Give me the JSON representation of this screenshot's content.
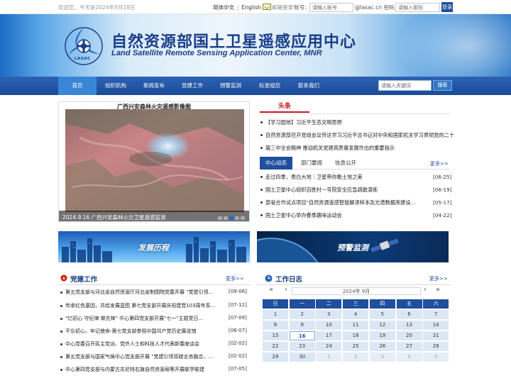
{
  "topbar": {
    "welcome": "欢迎您，今天是2024年9月18日",
    "lang_cn": "简体中文",
    "lang_sep": "|",
    "lang_en": "English",
    "mail_login": "邮箱登录",
    "account_label": "账号：",
    "account_placeholder": "请输入账号",
    "domain_suffix": "@lasac.cn  密码：",
    "password_placeholder": "请输入密码",
    "login_button": "登录"
  },
  "banner": {
    "title": "自然资源部国土卫星遥感应用中心",
    "subtitle": "Land Satellite Remote Sensing Application Center, MNR",
    "logo_caption": "LASAC"
  },
  "nav": {
    "items": [
      "首页",
      "组织机构",
      "新闻发布",
      "党建工作",
      "预警监测",
      "标准规范",
      "联系我们"
    ],
    "search_placeholder": "请输入关键词",
    "search_button": "搜索"
  },
  "slider": {
    "image_title": "广西兴安森林火灾遥感影像图",
    "caption": "2024.9.16 广西兴安森林火灾卫星遥感监测"
  },
  "headlines": {
    "tab": "头条",
    "items": [
      "【学习园地】习近平生态文明思想",
      "自然资源部召开党组会议传达学习习近平总书记对中央和国家机关学习贯彻党的二十",
      "届三中全会精神 推动机关党建高质量发展作出的重要指示"
    ]
  },
  "news": {
    "tabs": [
      "中心动态",
      "部门要闻",
      "信息公开"
    ],
    "more": "更多>>",
    "items": [
      {
        "title": "走过四季，表白大地｜卫星带你看土地之美",
        "date": "[06-25]"
      },
      {
        "title": "国土卫星中心组织百胜村一号院安全应急疏散演练",
        "date": "[06-19]"
      },
      {
        "title": "部省合作试点项目\"自然资源遥感智能解译样本及光谱数据库建设...",
        "date": "[05-17]"
      },
      {
        "title": "国土卫星中心举办春季趣味运动会",
        "date": "[04-22]"
      }
    ]
  },
  "promos": {
    "left": "发展历程",
    "right": "预警监测"
  },
  "party": {
    "title": "党建工作",
    "more": "更多>>",
    "items": [
      {
        "title": "第五党支部与河北省自然资源厅河北省制图院党委开展 \"党建引领...",
        "date": "[09-06]"
      },
      {
        "title": "传承红色基因，共绘发展蓝图 第七党支部开展庆祝建党103周年系...",
        "date": "[07-12]"
      },
      {
        "title": "\"忆初心 守纪律 做先锋\" 中心第四党支部开展\"七一\"主题党日...",
        "date": "[07-09]"
      },
      {
        "title": "不忘初心，牢记使命-第七党支部参观中国共产党历史展览馆",
        "date": "[06-07]"
      },
      {
        "title": "中心党委召开民主党派、党外人士和科技人才代表新春座谈会",
        "date": "[02-02]"
      },
      {
        "title": "第五党支部与国家气候中心党支部开展 \"党建引领双碳业务融合，...",
        "date": "[02-02]"
      },
      {
        "title": "中心第四党支部与内蒙古苏尼特右旗自然资源局等开展联学联建",
        "date": "[07-05]"
      }
    ]
  },
  "worklog": {
    "title": "工作日志",
    "more": "更多>>",
    "year_month": "2024年  9月",
    "weekdays": [
      "日",
      "一",
      "二",
      "三",
      "四",
      "五",
      "六"
    ],
    "days": [
      [
        "1",
        "2",
        "3",
        "4",
        "5",
        "6",
        "7"
      ],
      [
        "8",
        "9",
        "10",
        "11",
        "12",
        "13",
        "14"
      ],
      [
        "15",
        "16",
        "17",
        "18",
        "19",
        "20",
        "21"
      ],
      [
        "22",
        "23",
        "24",
        "25",
        "26",
        "27",
        "28"
      ],
      [
        "29",
        "30",
        "1",
        "2",
        "3",
        "4",
        "5"
      ]
    ],
    "today": "16"
  },
  "colors": {
    "nav_bg": "#1f4f9e",
    "nav_active": "#3a86d6",
    "headline_red": "#c9161d",
    "title_blue": "#1b3f86"
  }
}
